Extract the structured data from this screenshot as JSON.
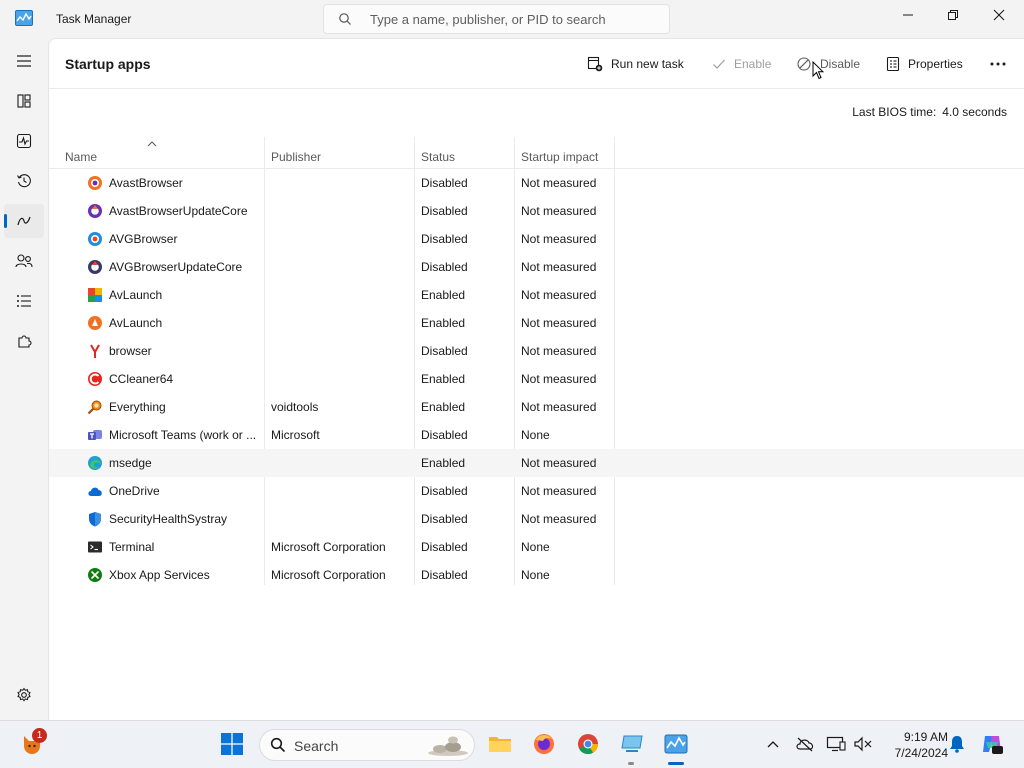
{
  "window": {
    "title": "Task Manager",
    "search_placeholder": "Type a name, publisher, or PID to search"
  },
  "toolbar": {
    "page_title": "Startup apps",
    "run_new_task": "Run new task",
    "enable": "Enable",
    "disable": "Disable",
    "properties": "Properties",
    "more": "..."
  },
  "bios": {
    "label": "Last BIOS time:",
    "value": "4.0 seconds"
  },
  "table": {
    "columns": [
      "Name",
      "Publisher",
      "Status",
      "Startup impact"
    ],
    "rows": [
      {
        "name": "AvastBrowser",
        "publisher": "",
        "status": "Disabled",
        "impact": "Not measured",
        "icon": "avast-browser-icon"
      },
      {
        "name": "AvastBrowserUpdateCore",
        "publisher": "",
        "status": "Disabled",
        "impact": "Not measured",
        "icon": "avast-update-icon"
      },
      {
        "name": "AVGBrowser",
        "publisher": "",
        "status": "Disabled",
        "impact": "Not measured",
        "icon": "avg-browser-icon"
      },
      {
        "name": "AVGBrowserUpdateCore",
        "publisher": "",
        "status": "Disabled",
        "impact": "Not measured",
        "icon": "avg-update-icon"
      },
      {
        "name": "AvLaunch",
        "publisher": "",
        "status": "Enabled",
        "impact": "Not measured",
        "icon": "avg-launch-icon"
      },
      {
        "name": "AvLaunch",
        "publisher": "",
        "status": "Enabled",
        "impact": "Not measured",
        "icon": "avast-launch-icon"
      },
      {
        "name": "browser",
        "publisher": "",
        "status": "Disabled",
        "impact": "Not measured",
        "icon": "yandex-browser-icon"
      },
      {
        "name": "CCleaner64",
        "publisher": "",
        "status": "Enabled",
        "impact": "Not measured",
        "icon": "ccleaner-icon"
      },
      {
        "name": "Everything",
        "publisher": "voidtools",
        "status": "Enabled",
        "impact": "Not measured",
        "icon": "everything-icon"
      },
      {
        "name": "Microsoft Teams (work or ...",
        "publisher": "Microsoft",
        "status": "Disabled",
        "impact": "None",
        "icon": "teams-icon"
      },
      {
        "name": "msedge",
        "publisher": "",
        "status": "Enabled",
        "impact": "Not measured",
        "icon": "edge-icon"
      },
      {
        "name": "OneDrive",
        "publisher": "",
        "status": "Disabled",
        "impact": "Not measured",
        "icon": "onedrive-icon"
      },
      {
        "name": "SecurityHealthSystray",
        "publisher": "",
        "status": "Disabled",
        "impact": "Not measured",
        "icon": "security-shield-icon"
      },
      {
        "name": "Terminal",
        "publisher": "Microsoft Corporation",
        "status": "Disabled",
        "impact": "None",
        "icon": "terminal-icon"
      },
      {
        "name": "Xbox App Services",
        "publisher": "Microsoft Corporation",
        "status": "Disabled",
        "impact": "None",
        "icon": "xbox-icon"
      }
    ]
  },
  "taskbar": {
    "search_label": "Search",
    "notification_count": "1",
    "time": "9:19 AM",
    "date": "7/24/2024"
  },
  "colors": {
    "accent": "#0067c0",
    "highlight_row": "#f5f5f5"
  }
}
